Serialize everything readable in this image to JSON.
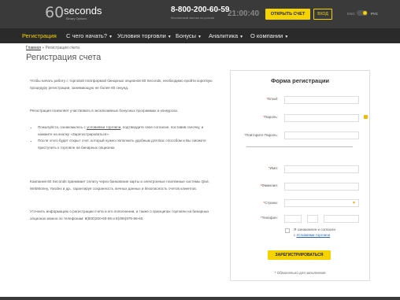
{
  "header": {
    "logo_mark": "60",
    "logo_word": "seconds",
    "logo_sub": "Binary Options",
    "phone": "8-800-200-60-59",
    "phone_sub": "бесплатный звонок по россии",
    "clock": "21:00:40",
    "open_account_label": "ОТКРЫТЬ СЧЕТ",
    "login_label": "ВХОД",
    "lang_eng": "ENG",
    "lang_rus": "РУС",
    "accent_color": "#f5d300"
  },
  "nav": {
    "items": [
      {
        "label": "Регистрация",
        "caret": ""
      },
      {
        "label": "С чего начать?",
        "caret": "▼"
      },
      {
        "label": "Условия торговли",
        "caret": "▼"
      },
      {
        "label": "Бонусы",
        "caret": "▼"
      },
      {
        "label": "Аналитика",
        "caret": "▼"
      },
      {
        "label": "О компании",
        "caret": "▼"
      }
    ]
  },
  "breadcrumb": {
    "home": "Главная",
    "sep": " » ",
    "current": "Регистрация счета"
  },
  "page_title": "Регистрация счета",
  "content": {
    "p1": "Чтобы начать работу с торговой платформой бинарных опционов 60 Seconds, необходимо пройти короткую процедуру регистрации, занимающую не более 60 секунд.",
    "p2": "Регистрация позволяет участвовать в эксклюзивных бонусных программах и конкурсах.",
    "b1_pre": "Пожалуйста, ознакомьтесь с ",
    "b1_link": "условиями торговли",
    "b1_post": ", подтвердите свое согласие, поставив галочку, и нажмите на кнопку «Зарегистрироваться».",
    "b2": "После этого будет открыт счет, который нужно пополнить удобным для Вас способом и Вы сможете приступить к торговле на бинарных опционах.",
    "p3": "Компания 60 Seconds принимает оплату через банковские карты и электронные платежные системы Qiwi, WebMoney, Yandex и др., гарантируя сохранность личных данных и безопасность счетов клиентов.",
    "p4": "Уточнить информацию о регистрации счета и его пополнении, а также о принципах торговли на бинарных опционах можно по телефонам: 8(800)200-60-59 и 8(495)975-96-60."
  },
  "form": {
    "title": "Форма регистрации",
    "required_mark": "*",
    "email_label": "Email:",
    "password_label": "Пароль:",
    "repeat_password_label": "Повторите Пароль:",
    "name_label": "Имя:",
    "surname_label": "Фамилия:",
    "country_label": "Страна:",
    "country_arrow": "▼",
    "phone_label": "Телефон:",
    "agree_line1": "Я ознакомлен и согласен",
    "agree_pre": "с ",
    "agree_link": "Условиями торговли",
    "submit_label": "ЗАРЕГИСТРИРОВАТЬСЯ",
    "note": "* Обязательно для заполнения"
  }
}
